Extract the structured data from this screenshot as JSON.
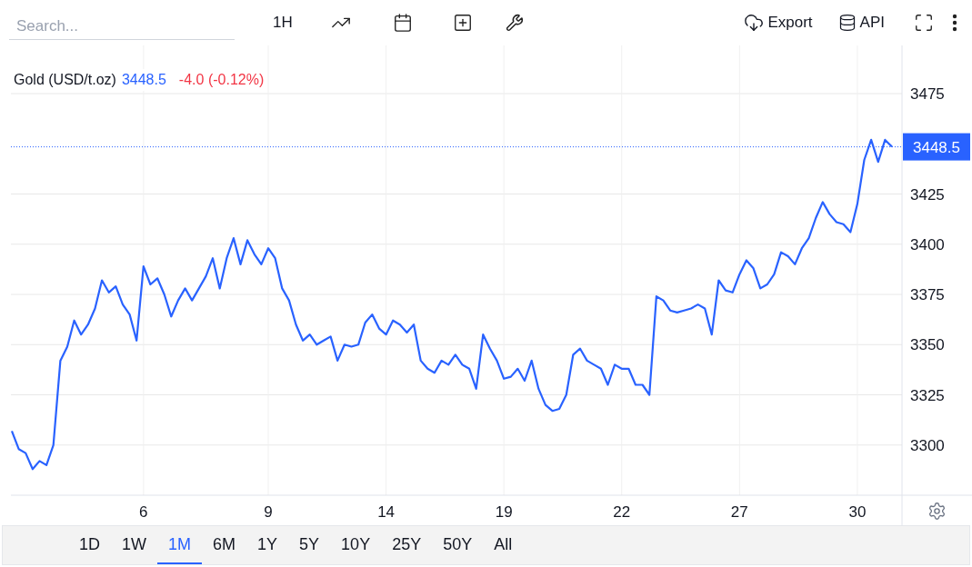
{
  "toolbar": {
    "search": {
      "placeholder": "Search..."
    },
    "interval": "1H",
    "export": "Export",
    "api": "API"
  },
  "legend": {
    "name": "Gold (USD/t.oz)",
    "price": "3448.5",
    "change": "-4.0 (-0.12%)"
  },
  "chart_data": {
    "type": "line",
    "categories": [
      null,
      null,
      null,
      null,
      null,
      null,
      null,
      null,
      null,
      null,
      null,
      null,
      null,
      null,
      null,
      null,
      null,
      null,
      null,
      "6",
      null,
      null,
      null,
      null,
      null,
      null,
      null,
      null,
      null,
      null,
      null,
      null,
      null,
      null,
      null,
      null,
      null,
      "9",
      null,
      null,
      null,
      null,
      null,
      null,
      null,
      null,
      null,
      null,
      null,
      null,
      null,
      null,
      null,
      null,
      "14",
      null,
      null,
      null,
      null,
      null,
      null,
      null,
      null,
      null,
      null,
      null,
      null,
      null,
      null,
      null,
      null,
      "19",
      null,
      null,
      null,
      null,
      null,
      null,
      null,
      null,
      null,
      null,
      null,
      null,
      null,
      null,
      null,
      null,
      "22",
      null,
      null,
      null,
      null,
      null,
      null,
      null,
      null,
      null,
      null,
      null,
      null,
      null,
      null,
      null,
      null,
      "27",
      null,
      null,
      null,
      null,
      null,
      null,
      null,
      null,
      null,
      null,
      null,
      null,
      null,
      null,
      null,
      null,
      "30",
      null,
      null,
      null,
      null,
      null
    ],
    "series": [
      {
        "color": "#2962ff",
        "values": [
          3307,
          3298,
          3296,
          3288,
          3292,
          3290,
          3300,
          3342,
          3349,
          3362,
          3355,
          3360,
          3368,
          3382,
          3376,
          3379,
          3370,
          3365,
          3352,
          3389,
          3380,
          3383,
          3375,
          3364,
          3372,
          3378,
          3372,
          3378,
          3384,
          3393,
          3378,
          3393,
          3403,
          3390,
          3402,
          3395,
          3390,
          3398,
          3393,
          3378,
          3372,
          3360,
          3352,
          3355,
          3350,
          3352,
          3354,
          3342,
          3350,
          3349,
          3350,
          3361,
          3365,
          3358,
          3355,
          3362,
          3360,
          3356,
          3360,
          3342,
          3338,
          3336,
          3342,
          3340,
          3345,
          3340,
          3338,
          3328,
          3355,
          3348,
          3342,
          3333,
          3334,
          3338,
          3332,
          3342,
          3328,
          3320,
          3317,
          3318,
          3325,
          3345,
          3348,
          3342,
          3340,
          3338,
          3330,
          3340,
          3338,
          3338,
          3330,
          3330,
          3325,
          3374,
          3372,
          3367,
          3366,
          3367,
          3368,
          3370,
          3368,
          3355,
          3382,
          3377,
          3376,
          3385,
          3392,
          3388,
          3378,
          3380,
          3385,
          3396,
          3394,
          3390,
          3398,
          3403,
          3413,
          3421,
          3415,
          3411,
          3410,
          3406,
          3420,
          3442,
          3452,
          3441,
          3452,
          3448.5
        ]
      }
    ],
    "ylim": [
      3275,
      3499
    ],
    "grid": true,
    "ref_lines": [
      {
        "axis": "y",
        "value": 3448.5,
        "label": "3448.5"
      }
    ],
    "yticks": [
      3300,
      3325,
      3350,
      3375,
      3400,
      3425,
      3475
    ]
  },
  "ranges": [
    {
      "label": "1D",
      "selected": false
    },
    {
      "label": "1W",
      "selected": false
    },
    {
      "label": "1M",
      "selected": true
    },
    {
      "label": "6M",
      "selected": false
    },
    {
      "label": "1Y",
      "selected": false
    },
    {
      "label": "5Y",
      "selected": false
    },
    {
      "label": "10Y",
      "selected": false
    },
    {
      "label": "25Y",
      "selected": false
    },
    {
      "label": "50Y",
      "selected": false
    },
    {
      "label": "All",
      "selected": false
    }
  ]
}
